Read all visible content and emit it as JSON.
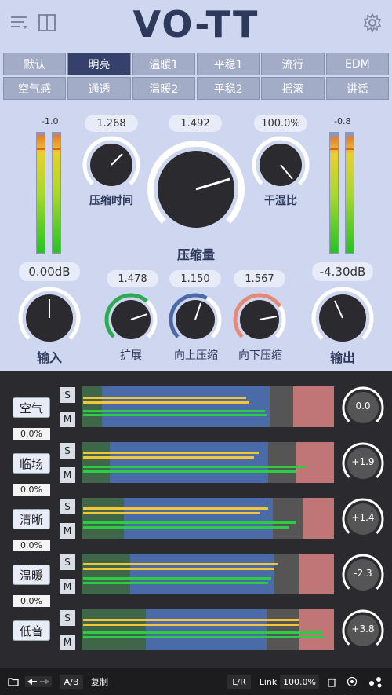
{
  "header": {
    "title": "VO-TT"
  },
  "presets": [
    "默认",
    "明亮",
    "温暖1",
    "平稳1",
    "流行",
    "EDM",
    "空气感",
    "通透",
    "温暖2",
    "平稳2",
    "摇滚",
    "讲话"
  ],
  "active_preset": 1,
  "meters": {
    "input_peak": "-1.0",
    "output_peak": "-0.8",
    "input_level": 0.85,
    "output_level": 0.84
  },
  "knobs": {
    "comp_time": {
      "value": "1.268",
      "label": "压缩时间"
    },
    "comp_amount": {
      "value": "1.492",
      "label": "压缩量"
    },
    "dry_wet": {
      "value": "100.0%",
      "label": "干湿比"
    },
    "input": {
      "value": "0.00dB",
      "label": "输入"
    },
    "expand": {
      "value": "1.478",
      "label": "扩展"
    },
    "up_comp": {
      "value": "1.150",
      "label": "向上压缩"
    },
    "down_comp": {
      "value": "1.567",
      "label": "向下压缩"
    },
    "output": {
      "value": "-4.30dB",
      "label": "输出"
    }
  },
  "bands": [
    {
      "name": "空气",
      "pct": "0.0%",
      "gain": "0.0"
    },
    {
      "name": "临场",
      "pct": "0.0%",
      "gain": "+1.9"
    },
    {
      "name": "清晰",
      "pct": "0.0%",
      "gain": "+1.4"
    },
    {
      "name": "温暖",
      "pct": "0.0%",
      "gain": "-2.3"
    },
    {
      "name": "低音",
      "pct": "",
      "gain": "+3.8"
    }
  ],
  "solo_label": "S",
  "mute_label": "M",
  "footer": {
    "ab": "A/B",
    "copy": "复制",
    "lr": "L/R",
    "link_label": "Link",
    "link_value": "100.0%"
  }
}
